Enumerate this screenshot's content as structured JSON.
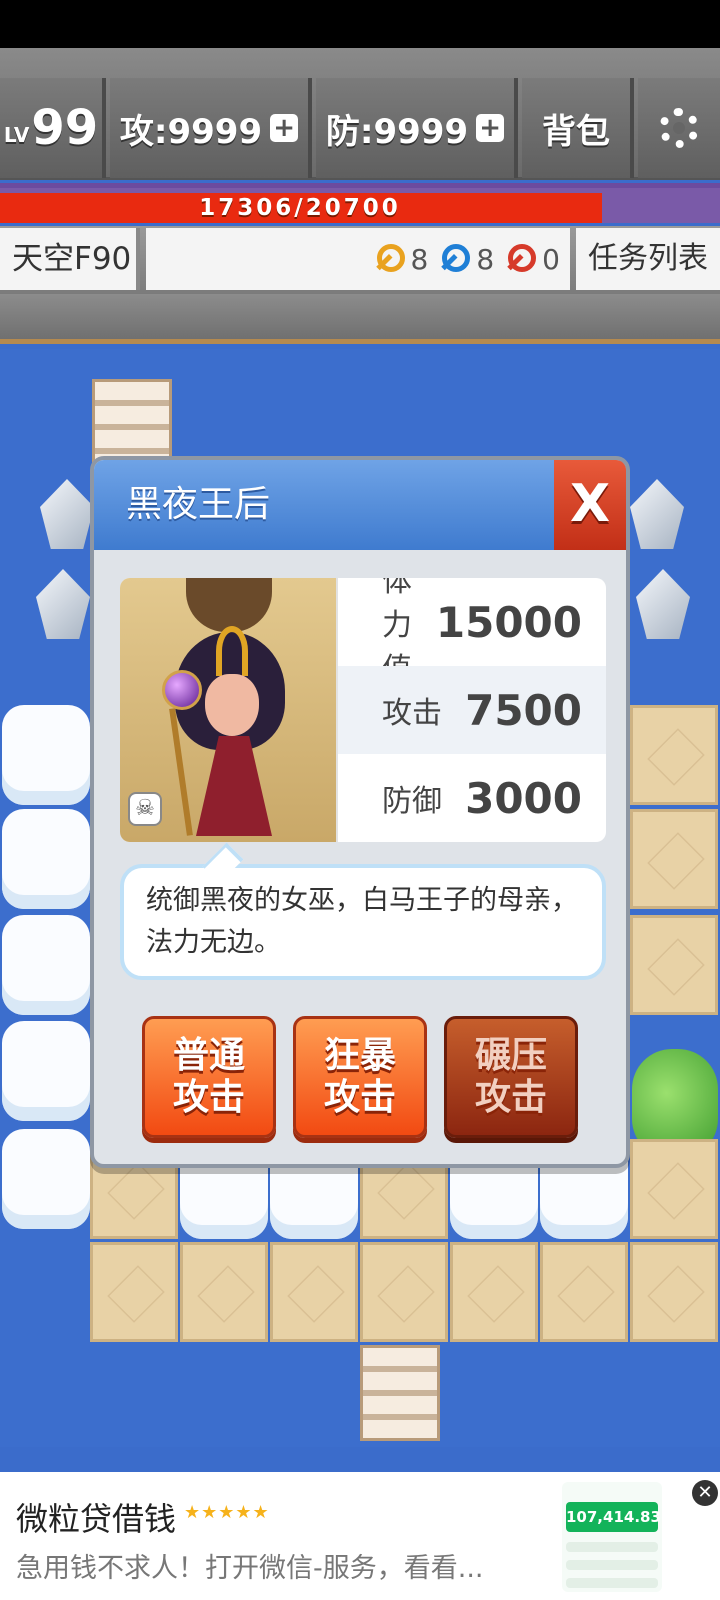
{
  "hud": {
    "level_prefix": "LV",
    "level": "99",
    "attack": "攻:9999",
    "defense": "防:9999",
    "plus_symbol": "+",
    "bag": "背包",
    "settings_icon": "gear-icon",
    "hp": {
      "text": "17306/20700",
      "current": 17306,
      "max": 20700,
      "fill_color": "#e92a10"
    },
    "floor": "天空F90",
    "keys": [
      {
        "color": "yellow",
        "hex": "#e9a21f",
        "count": "8"
      },
      {
        "color": "blue",
        "hex": "#1f7fd6",
        "count": "8"
      },
      {
        "color": "red",
        "hex": "#d63a2a",
        "count": "0"
      }
    ],
    "task_list": "任务列表"
  },
  "dialog": {
    "title": "黑夜王后",
    "close_label": "X",
    "stats": [
      {
        "label": "体力值",
        "value": "15000"
      },
      {
        "label": "攻击",
        "value": "7500"
      },
      {
        "label": "防御",
        "value": "3000"
      }
    ],
    "description": "统御黑夜的女巫，白马王子的母亲，法力无边。",
    "buttons": [
      {
        "line1": "普通",
        "line2": "攻击"
      },
      {
        "line1": "狂暴",
        "line2": "攻击"
      },
      {
        "line1": "碾压",
        "line2": "攻击"
      }
    ]
  },
  "ad": {
    "title": "微粒贷借钱",
    "stars": "★★★★★",
    "subtitle": "急用钱不求人！打开微信-服务，看看...",
    "card_amount": "107,414.83",
    "close_label": "✕"
  }
}
